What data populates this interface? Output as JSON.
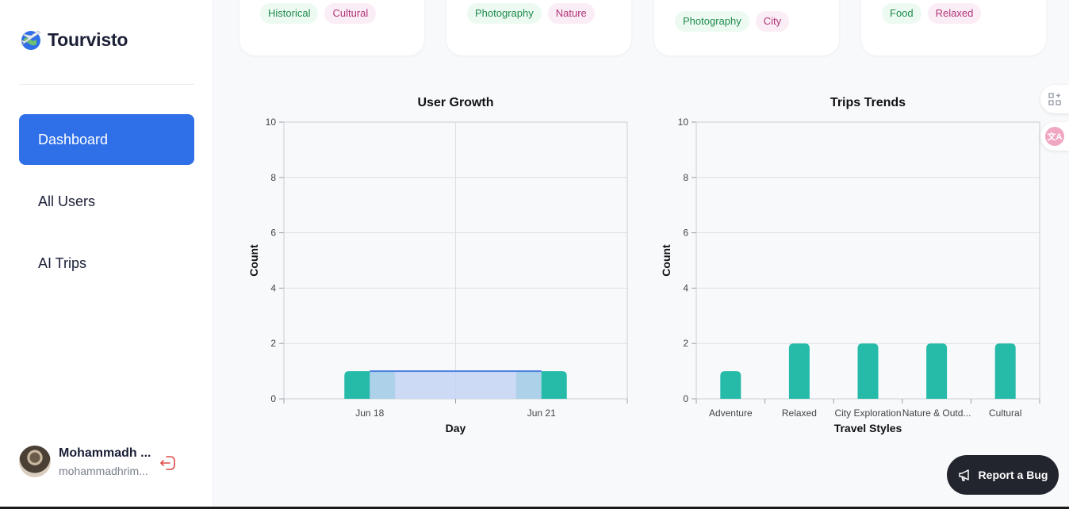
{
  "brand": {
    "name": "Tourvisto",
    "logo_icon": "airplane-globe-icon"
  },
  "nav": [
    {
      "label": "Dashboard",
      "active": true
    },
    {
      "label": "All Users",
      "active": false
    },
    {
      "label": "AI Trips",
      "active": false
    }
  ],
  "user": {
    "name": "Mohammadh ...",
    "email": "mohammadhrim...",
    "logout_icon": "logout-icon"
  },
  "trip_cards": [
    {
      "tags": [
        "Historical",
        "Cultural"
      ]
    },
    {
      "tags": [
        "Photography",
        "Nature"
      ]
    },
    {
      "tags": [
        "Photography",
        "City"
      ]
    },
    {
      "tags": [
        "Food",
        "Relaxed"
      ]
    }
  ],
  "report_bug": {
    "label": "Report a Bug",
    "icon": "megaphone-icon"
  },
  "colors": {
    "accent": "#2f6fe8",
    "teal": "#26bba9",
    "area": "#c5d5f5",
    "area_line": "#4a7ee0"
  },
  "chart_data": [
    {
      "type": "bar",
      "title": "User Growth",
      "xlabel": "Day",
      "ylabel": "Count",
      "categories": [
        "Jun 18",
        "Jun 21"
      ],
      "series": [
        {
          "type": "bar",
          "values": [
            1,
            1
          ]
        },
        {
          "type": "area",
          "values": [
            1,
            1
          ]
        }
      ],
      "ylim": [
        0,
        10
      ],
      "yticks": [
        0,
        2,
        4,
        6,
        8,
        10
      ],
      "grid": true
    },
    {
      "type": "bar",
      "title": "Trips Trends",
      "xlabel": "Travel Styles",
      "ylabel": "Count",
      "categories": [
        "Adventure",
        "Relaxed",
        "City Exploration",
        "Nature & Outd...",
        "Cultural"
      ],
      "series": [
        {
          "values": [
            1,
            2,
            2,
            2,
            2
          ]
        }
      ],
      "ylim": [
        0,
        10
      ],
      "yticks": [
        0,
        2,
        4,
        6,
        8,
        10
      ],
      "grid": true
    }
  ]
}
